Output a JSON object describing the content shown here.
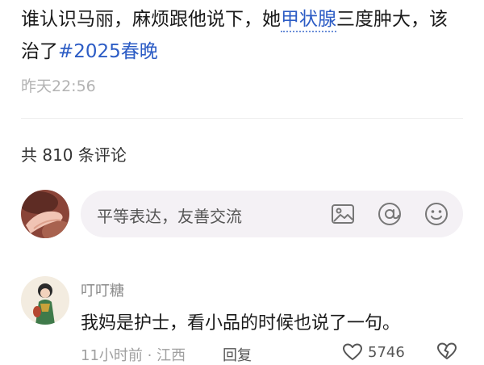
{
  "post": {
    "text_before": "谁认识马丽，麻烦跟他说下，她",
    "topic_link": "甲状腺",
    "text_after": "三度肿大，该治了",
    "hashtag": "#2025春晚",
    "time": "昨天22:56"
  },
  "comments_header": {
    "count_label": "共 810 条评论"
  },
  "composer": {
    "placeholder": "平等表达，友善交流",
    "icons": [
      "image-icon",
      "at-icon",
      "emoji-icon"
    ]
  },
  "comment": {
    "author": "叮叮糖",
    "text": "我妈是护士，看小品的时候也说了一句。",
    "time_location": "11小时前 · 江西",
    "reply_label": "回复",
    "like_count": "5746"
  },
  "colors": {
    "link": "#2c5cc5",
    "muted": "#b3b3b3",
    "composer_bg": "#f4f1f5"
  }
}
